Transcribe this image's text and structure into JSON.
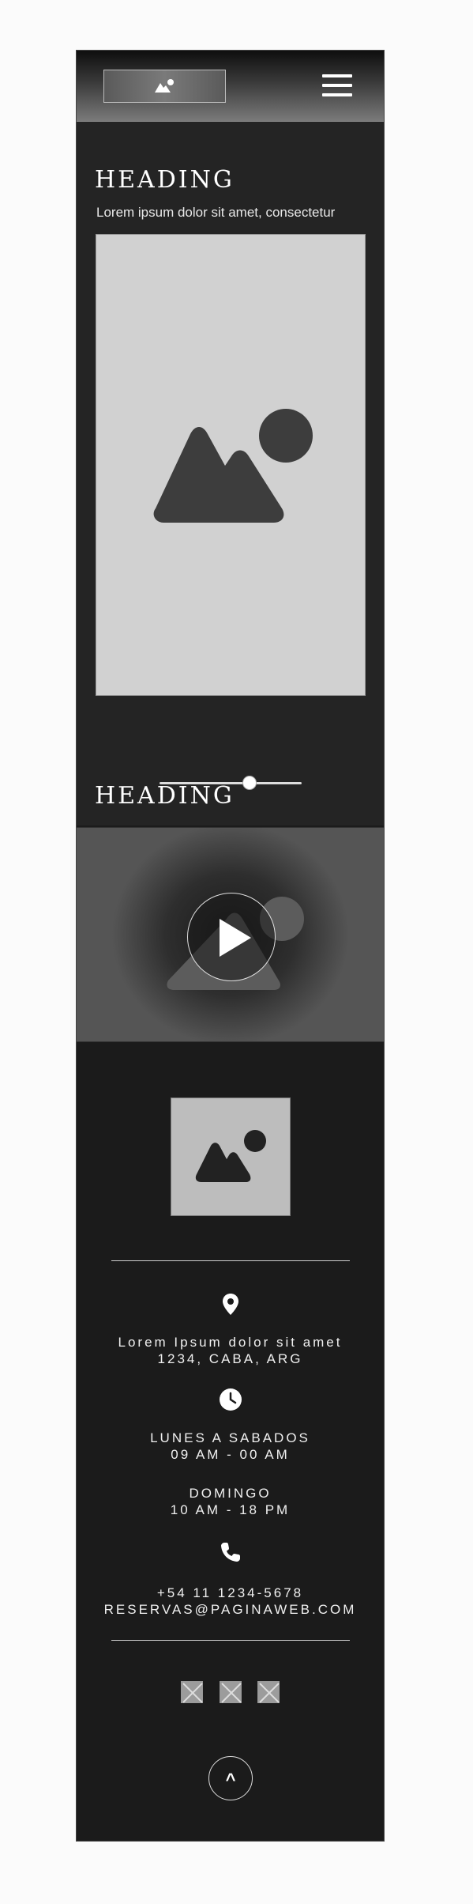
{
  "header": {
    "logo_icon": "image-placeholder-icon",
    "menu_icon": "hamburger-menu-icon"
  },
  "hero": {
    "heading": "HEADING",
    "subtitle": "Lorem ipsum dolor sit amet, consectetur",
    "image_icon": "image-placeholder-icon",
    "slider_value": 0.65
  },
  "video_section": {
    "heading": "HEADING",
    "play_icon": "play-icon"
  },
  "footer": {
    "logo_icon": "image-placeholder-icon",
    "address": {
      "icon": "location-pin-icon",
      "line1": "Lorem Ipsum dolor sit amet",
      "line2": "1234, CABA, ARG"
    },
    "hours": {
      "icon": "clock-icon",
      "weekdays_label": "LUNES A SABADOS",
      "weekdays_time": "09 AM - 00 AM",
      "sunday_label": "DOMINGO",
      "sunday_time": "10 AM - 18 PM"
    },
    "contact": {
      "icon": "phone-icon",
      "phone": "+54 11 1234-5678",
      "email": "RESERVAS@PAGINAWEB.COM"
    },
    "social_icons": [
      "social-placeholder-icon",
      "social-placeholder-icon",
      "social-placeholder-icon"
    ],
    "back_to_top_label": "^"
  },
  "colors": {
    "page_background": "#fbfbfb",
    "section_dark": "#242424",
    "footer_dark": "#1b1b1b",
    "image_placeholder": "#d1d1d1",
    "text": "#ffffff"
  }
}
